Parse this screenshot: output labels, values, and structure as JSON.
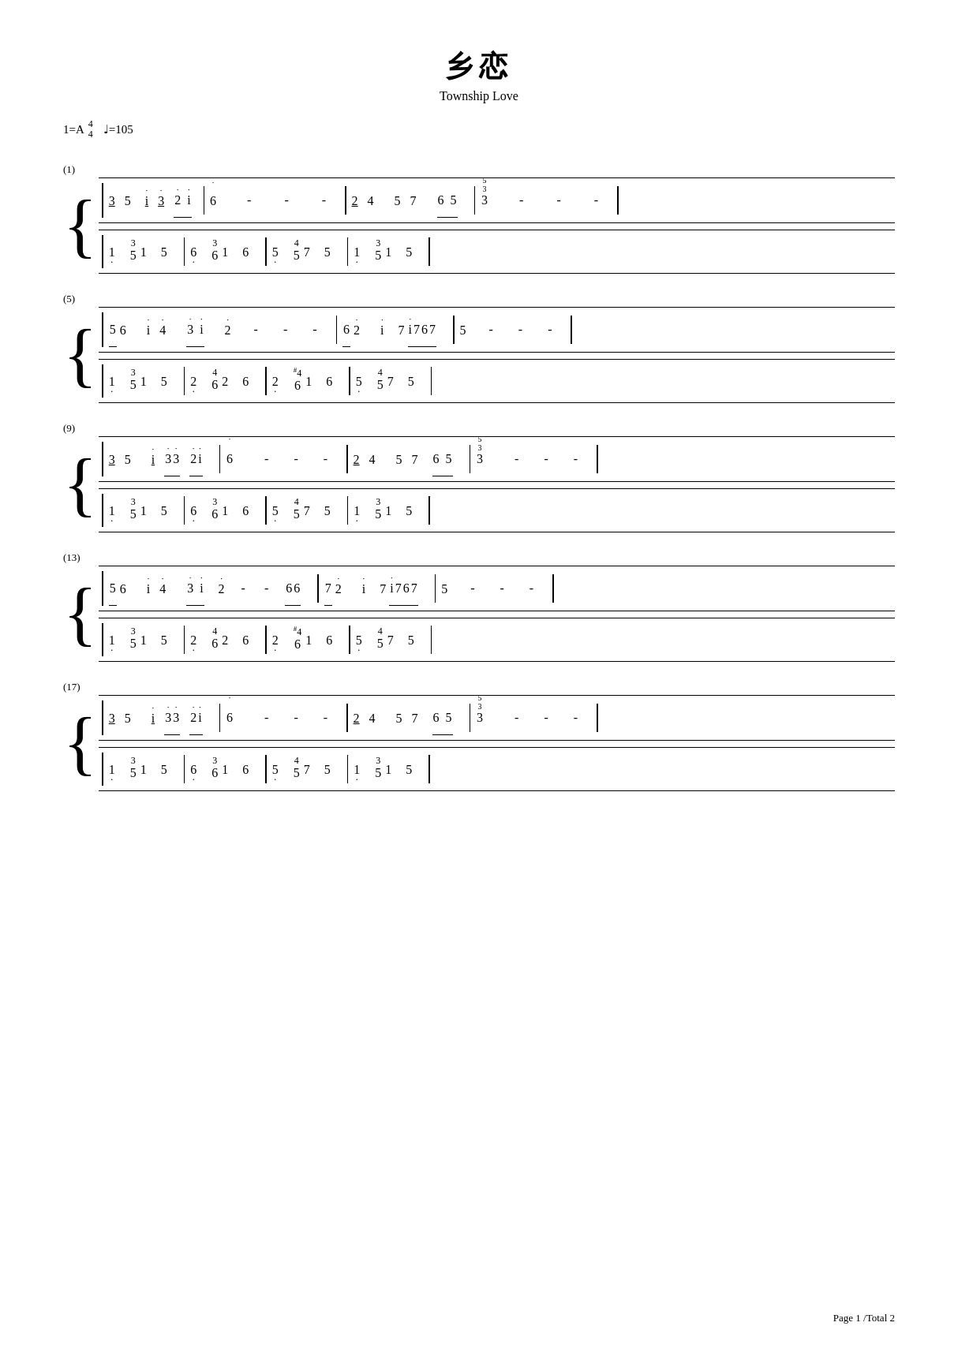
{
  "title": {
    "chinese": "乡恋",
    "english": "Township Love"
  },
  "tempo": {
    "key": "1=A",
    "time_sig_top": "4",
    "time_sig_bottom": "4",
    "bpm": "♩=105"
  },
  "footer": "Page 1 /Total 2",
  "sections": [
    {
      "label": "(1)"
    },
    {
      "label": "(5)"
    },
    {
      "label": "(9)"
    },
    {
      "label": "(13)"
    },
    {
      "label": "(17)"
    }
  ]
}
